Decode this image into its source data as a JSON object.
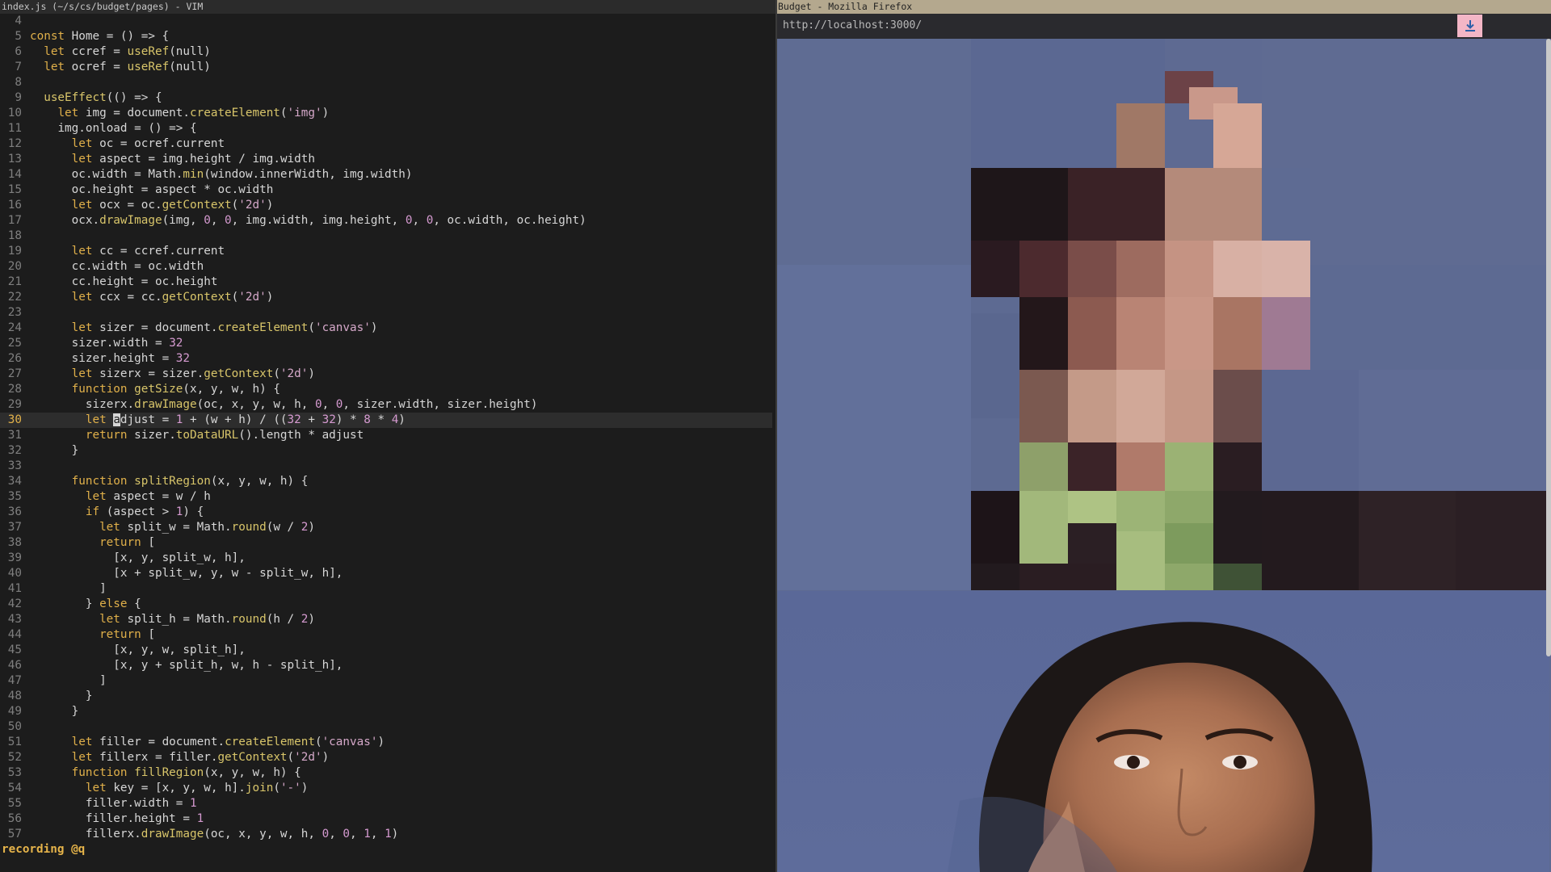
{
  "vim": {
    "title": "index.js (~/s/cs/budget/pages) - VIM",
    "cmdline": "recording @q",
    "cursor_line": 30,
    "lines": [
      {
        "n": "4",
        "code": ""
      },
      {
        "n": "5",
        "code": "const Home = () => {"
      },
      {
        "n": "6",
        "code": "  let ccref = useRef(null)"
      },
      {
        "n": "7",
        "code": "  let ocref = useRef(null)"
      },
      {
        "n": "8",
        "code": ""
      },
      {
        "n": "9",
        "code": "  useEffect(() => {"
      },
      {
        "n": "10",
        "code": "    let img = document.createElement('img')"
      },
      {
        "n": "11",
        "code": "    img.onload = () => {"
      },
      {
        "n": "12",
        "code": "      let oc = ocref.current"
      },
      {
        "n": "13",
        "code": "      let aspect = img.height / img.width"
      },
      {
        "n": "14",
        "code": "      oc.width = Math.min(window.innerWidth, img.width)"
      },
      {
        "n": "15",
        "code": "      oc.height = aspect * oc.width"
      },
      {
        "n": "16",
        "code": "      let ocx = oc.getContext('2d')"
      },
      {
        "n": "17",
        "code": "      ocx.drawImage(img, 0, 0, img.width, img.height, 0, 0, oc.width, oc.height)"
      },
      {
        "n": "18",
        "code": ""
      },
      {
        "n": "19",
        "code": "      let cc = ccref.current"
      },
      {
        "n": "20",
        "code": "      cc.width = oc.width"
      },
      {
        "n": "21",
        "code": "      cc.height = oc.height"
      },
      {
        "n": "22",
        "code": "      let ccx = cc.getContext('2d')"
      },
      {
        "n": "23",
        "code": ""
      },
      {
        "n": "24",
        "code": "      let sizer = document.createElement('canvas')"
      },
      {
        "n": "25",
        "code": "      sizer.width = 32"
      },
      {
        "n": "26",
        "code": "      sizer.height = 32"
      },
      {
        "n": "27",
        "code": "      let sizerx = sizer.getContext('2d')"
      },
      {
        "n": "28",
        "code": "      function getSize(x, y, w, h) {"
      },
      {
        "n": "29",
        "code": "        sizerx.drawImage(oc, x, y, w, h, 0, 0, sizer.width, sizer.height)"
      },
      {
        "n": "30",
        "code": "        let adjust = 1 + (w + h) / ((32 + 32) * 8 * 4)"
      },
      {
        "n": "31",
        "code": "        return sizer.toDataURL().length * adjust"
      },
      {
        "n": "32",
        "code": "      }"
      },
      {
        "n": "33",
        "code": ""
      },
      {
        "n": "34",
        "code": "      function splitRegion(x, y, w, h) {"
      },
      {
        "n": "35",
        "code": "        let aspect = w / h"
      },
      {
        "n": "36",
        "code": "        if (aspect > 1) {"
      },
      {
        "n": "37",
        "code": "          let split_w = Math.round(w / 2)"
      },
      {
        "n": "38",
        "code": "          return ["
      },
      {
        "n": "39",
        "code": "            [x, y, split_w, h],"
      },
      {
        "n": "40",
        "code": "            [x + split_w, y, w - split_w, h],"
      },
      {
        "n": "41",
        "code": "          ]"
      },
      {
        "n": "42",
        "code": "        } else {"
      },
      {
        "n": "43",
        "code": "          let split_h = Math.round(h / 2)"
      },
      {
        "n": "44",
        "code": "          return ["
      },
      {
        "n": "45",
        "code": "            [x, y, w, split_h],"
      },
      {
        "n": "46",
        "code": "            [x, y + split_h, w, h - split_h],"
      },
      {
        "n": "47",
        "code": "          ]"
      },
      {
        "n": "48",
        "code": "        }"
      },
      {
        "n": "49",
        "code": "      }"
      },
      {
        "n": "50",
        "code": ""
      },
      {
        "n": "51",
        "code": "      let filler = document.createElement('canvas')"
      },
      {
        "n": "52",
        "code": "      let fillerx = filler.getContext('2d')"
      },
      {
        "n": "53",
        "code": "      function fillRegion(x, y, w, h) {"
      },
      {
        "n": "54",
        "code": "        let key = [x, y, w, h].join('-')"
      },
      {
        "n": "55",
        "code": "        filler.width = 1"
      },
      {
        "n": "56",
        "code": "        filler.height = 1"
      },
      {
        "n": "57",
        "code": "        fillerx.drawImage(oc, x, y, w, h, 0, 0, 1, 1)"
      }
    ]
  },
  "firefox": {
    "title": "Budget - Mozilla Firefox",
    "url": "http://localhost:3000/",
    "download_icon": "download-arrow-icon",
    "mosaic_image": "pixelated-portrait",
    "photo_image": "woman-portrait-photo"
  },
  "colors": {
    "background_blue": "#5d6a92",
    "download_button": "#f3b6c6"
  }
}
